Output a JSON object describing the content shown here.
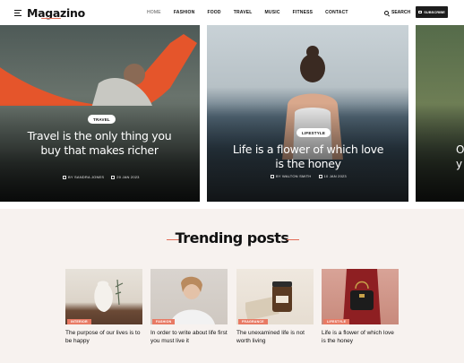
{
  "header": {
    "logo": "Magazino",
    "nav": [
      "HOME",
      "FASHION",
      "FOOD",
      "TRAVEL",
      "MUSIC",
      "FITNESS",
      "CONTACT"
    ],
    "search_label": "SEARCH",
    "subscribe_label": "SUBSCRIBE",
    "accent_color": "#e26b55"
  },
  "hero": [
    {
      "tag": "TRAVEL",
      "title": "Travel is the only thing you buy that makes richer",
      "author": "BY SANDRA JONES",
      "date": "20 JAN 2023"
    },
    {
      "tag": "LIFESTYLE",
      "title": "Life is a flower of which love is the honey",
      "author": "BY WALTON SMITH",
      "date": "10 JAN 2023"
    },
    {
      "partial_1": "O",
      "partial_2": "y"
    }
  ],
  "trending": {
    "title": "Trending posts",
    "posts": [
      {
        "category": "INTERIOR",
        "title": "The purpose of our lives is to be happy"
      },
      {
        "category": "FASHION",
        "title": "In order to write about life first you must live it"
      },
      {
        "category": "FRAGRANCE",
        "title": "The unexamined life is not worth living"
      },
      {
        "category": "LIFESTYLE",
        "title": "Life is a flower of which love is the honey"
      }
    ]
  }
}
